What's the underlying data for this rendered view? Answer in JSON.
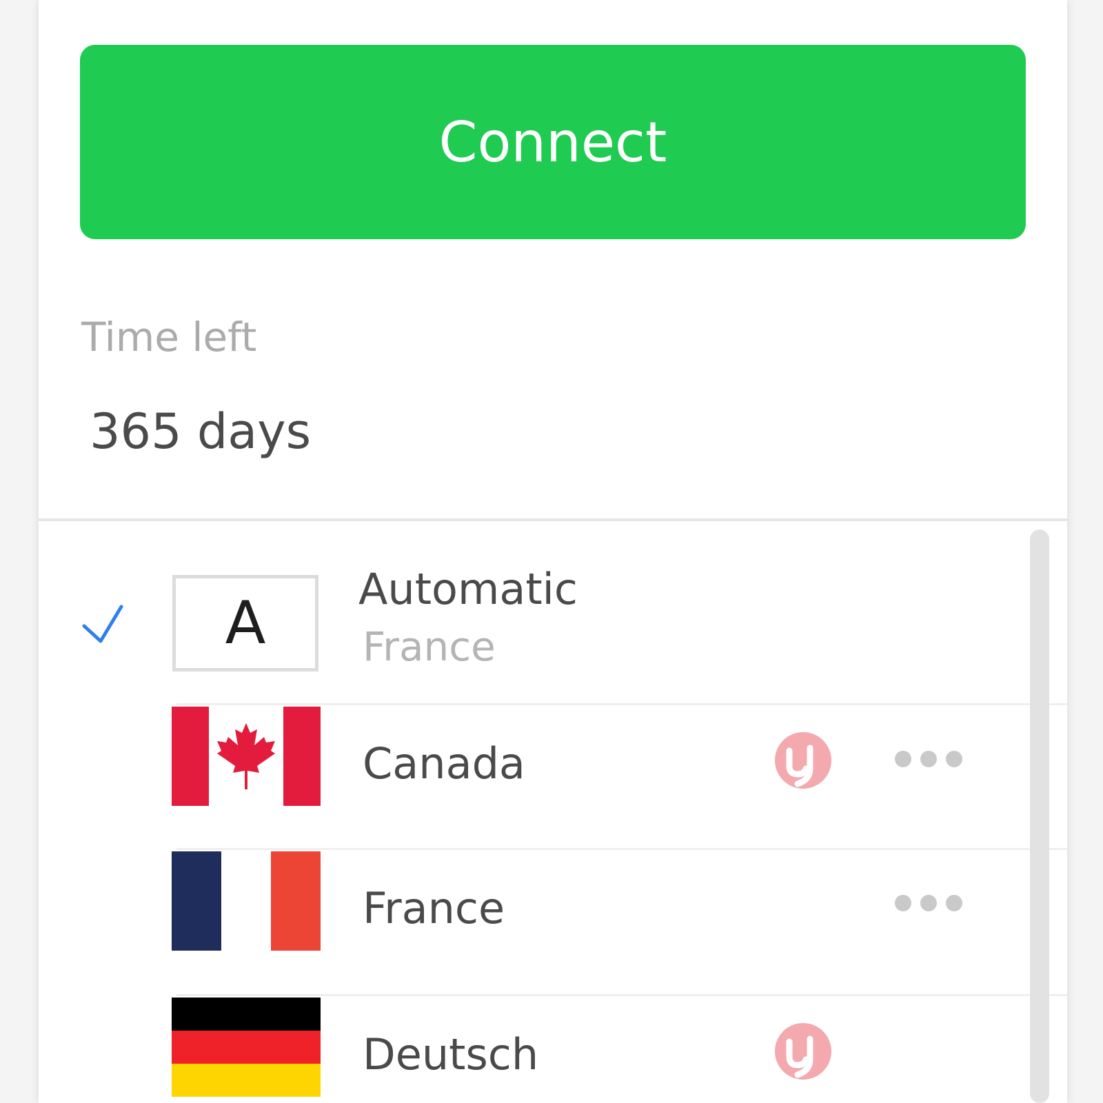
{
  "connect": {
    "label": "Connect"
  },
  "subscription": {
    "time_left_label": "Time left",
    "time_left_value": "365 days"
  },
  "locations": [
    {
      "id": "automatic",
      "badge": "A",
      "name": "Automatic",
      "subtitle": "France",
      "selected": true
    },
    {
      "id": "canada",
      "name": "Canada",
      "torrent": true,
      "more": true
    },
    {
      "id": "france",
      "name": "France",
      "torrent": false,
      "more": true
    },
    {
      "id": "deutsch",
      "name": "Deutsch",
      "torrent": true,
      "more": false
    }
  ],
  "colors": {
    "accent_green": "#1fcb50",
    "check_blue": "#2f80ed",
    "torrent_pink": "#f3a9ad"
  },
  "icons": {
    "check": "check-icon",
    "torrent": "utorrent-icon",
    "more": "more-dots-icon"
  }
}
